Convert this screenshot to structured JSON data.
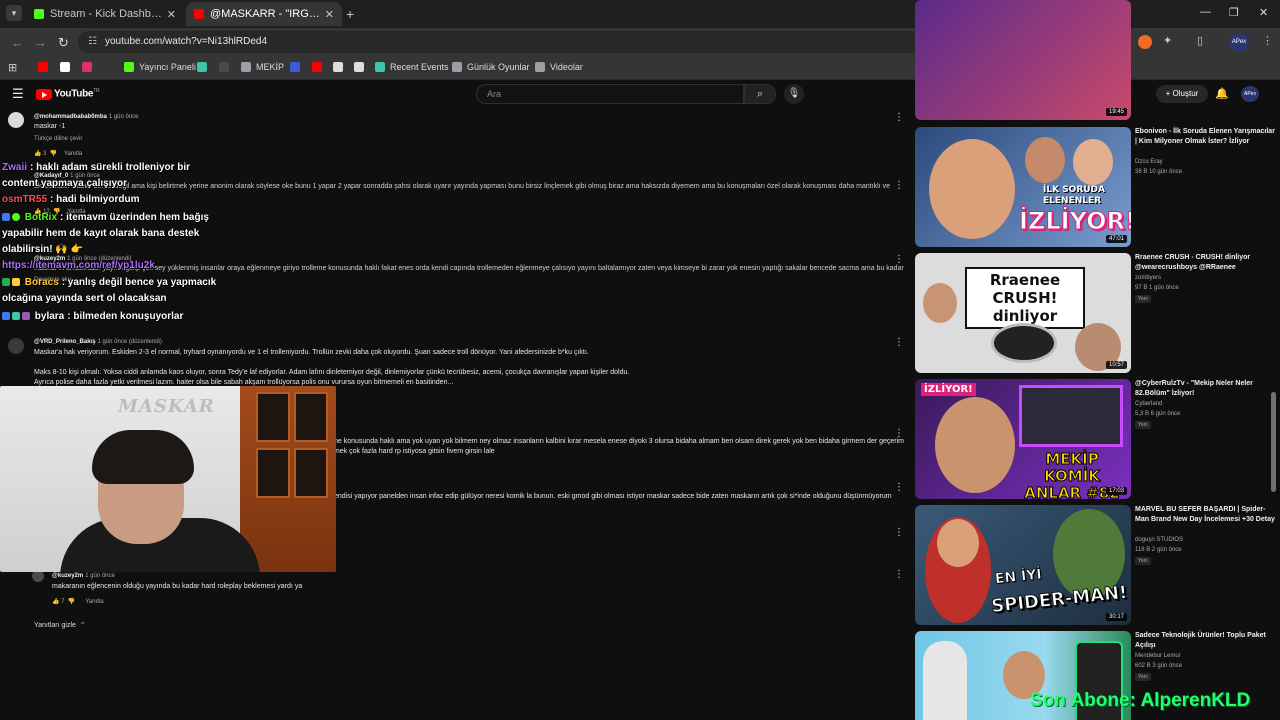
{
  "browser": {
    "tabs": [
      {
        "title": "Stream - Kick Dashboard",
        "color": "#53fc18"
      },
      {
        "title": "@MASKARR - \"IRGATLARIN GÜ",
        "color": "#ff0000"
      }
    ],
    "url": "youtube.com/watch?v=Ni13hlRDed4",
    "bookmarks": [
      {
        "label": "",
        "color": "#ff0000"
      },
      {
        "label": "",
        "color": "#ffffff"
      },
      {
        "label": "",
        "color": "#e1306c"
      },
      {
        "label": "Yayıncı Paneli",
        "color": "#53fc18"
      },
      {
        "label": "",
        "color": "#3ec6a8"
      },
      {
        "label": "MEKİP",
        "color": "#9aa0a6"
      },
      {
        "label": "",
        "color": "#3b5bdb"
      },
      {
        "label": "",
        "color": "#ff0000"
      },
      {
        "label": "",
        "color": "#dddddd"
      },
      {
        "label": "",
        "color": "#dddddd"
      },
      {
        "label": "Recent Events",
        "color": "#3ec6a8"
      },
      {
        "label": "Günlük Oyunlar",
        "color": "#9aa0a6"
      },
      {
        "label": "Videolar",
        "color": "#9aa0a6"
      }
    ],
    "profile_label": "APex"
  },
  "youtube": {
    "logo_text": "YouTube",
    "logo_region": "TR",
    "search_placeholder": "Ara",
    "create_label": "+ Oluştur",
    "avatar_label": "APex"
  },
  "comments": {
    "c1_author": "@mohammadbabab0mba",
    "c1_time": "1 gün önce",
    "c1_text": "maskar -1",
    "c1_translate": "Türkçe diline çevir",
    "c1_likes": "3",
    "c1_reply": "Yanıtla",
    "c2_author": "@Kadayıf_0",
    "c2_time": "1 gün önce",
    "c2_text": "aksde haklı olabilir bence değil ama kişi belirtmek yerine anonim olarak söylese oke bunu 1 yapar 2 yapar sonradda şahsi olarak uyarır yayında yapması bunu birsiz linçlemek gibi olmuş biraz ama haksızda diyemem ama bu konuşmaları özel olarak konuşması daha mantıklı ve",
    "c2_likes": "12",
    "c2_reply": "Yanıtla",
    "c3_author": "@kuzey2m",
    "c3_time": "1 gün önce (düzenlendi)",
    "c3_text": "maskar'ın arkasından yayına gelip çok sey yüklenmiş insanlar oraya eğlenmeye giriyo trolleme konusunda haklı fakat enes orda kendi capında trollemeden eğlenmeye çalısıyo yayını baltalamıyor zaten veya kimseye bi zarar yok enesin yaptığı sakalar bencede sacma ama bu kadar",
    "c3_more": "Devamını oku",
    "c4_author": "@VRD_Prileno_Bakış",
    "c4_time": "1 gün önce (düzenlendi)",
    "c4_line1": "Maskar'a hak veriyorum. Eskiden 2-3 el normal, tryhard oynanıyordu ve 1 el trolleniyordu. Trollün zevki daha çok oluyordu. Şuan sadece troll dönüyor. Yani afedersinizde b*ku çıktı.",
    "c4_line2": "Maks 8-10 kişi olmalı. Yoksa ciddi anlamda kaos oluyor, sonra Tedy'e laf ediyorlar. Adam lafını dinletemiyor değil, dinlemiyorlar çünkü tecrübesiz, acemi, çocukça davranışlar yapan kişiler doldu.",
    "c4_line3": "Ayrıca polise daha fazla yetki verilmesi lazım. haiter olsa bile sabah akşam trollüyorsa polis onu vurursa oyun bitmemeli en basitinden...",
    "c5_line1": "ne konusunda haklı ama yok uyan yok bilmem ney olmaz insanların kalbini kırar mesela enese diyoki 3 olursa bidaha almam ben olsam direk gerek yok ben bidaha girmem der geçerim",
    "c5_line2": "mek çok fazla hard rp istiyosa gitsin fivem girsin lale",
    "c6_line1": "endisi yapıyor panelden insan infaz edip gülüyor neresi komik la bunun. eski gmod gibi olması istiyor maskar sadece bide zaten maskarın artık çok  si*inde olduğunu düşünmüyorum",
    "c7_author": "@kuzey2m",
    "c7_time": "1 gün önce",
    "c7_text": "makaranın eğlencenin olduğu yayında bu kadar hard roleplay beklemesi yardı ya",
    "c7_likes": "7",
    "c7_reply": "Yanıtla",
    "hide_replies": "Yanıtları gizle"
  },
  "chat_overlay": {
    "lines": [
      {
        "user": "Zwaii",
        "user_color": "#b06cff",
        "text": ": haklı adam sürekli trolleniyor bir"
      },
      {
        "user": "",
        "user_color": "#ffffff",
        "text": "content yapmaya çalışıyor"
      },
      {
        "user": "osmTR55",
        "user_color": "#ff4d4d",
        "text": ": hadi bilmiyordum"
      },
      {
        "user": "BotRix",
        "user_color": "#53fc18",
        "text": ": itemavm üzerinden hem bağış"
      },
      {
        "user": "",
        "user_color": "#ffffff",
        "text": "yapabilir hem de kayıt olarak bana destek"
      },
      {
        "user": "",
        "user_color": "#ffffff",
        "text": "olabilirsin! 🙌 👉"
      },
      {
        "user": "",
        "user_color": "#b06cff",
        "text": "https://itemavm.com/ref/yp1lu2k"
      },
      {
        "user": "Boracs",
        "user_color": "#ffcc33",
        "text": ": yanlış değil bence ya yapmacık"
      },
      {
        "user": "",
        "user_color": "#ffffff",
        "text": "olcağına yayında sert ol olacaksan"
      },
      {
        "user": "bylara",
        "user_color": "#ffffff",
        "text": ": bilmeden konuşuyorlar"
      }
    ]
  },
  "webcam": {
    "wall_text": "MASKAR"
  },
  "recommended": [
    {
      "title": "",
      "channel": "",
      "meta": "",
      "badge": "",
      "duration": "19:45"
    },
    {
      "title": "Ebonivon - İlk Soruda Elenen Yarışmacılar | Kim Milyoner Olmak İster? İzliyor",
      "channel": "Dzcu Eray",
      "meta": "38 B   10 gün önce",
      "badge": "",
      "duration": "47:01",
      "thumb_text": "İZLİYOR!",
      "thumb_sub": "İLK SORUDA ELENENLER"
    },
    {
      "title": "Rraenee CRUSH - CRUSH! dinliyor @wearecrushboys @RRaenee",
      "channel": "zombyers",
      "meta": "97 B   1 gün önce",
      "badge": "Yeni",
      "duration": "10:57",
      "thumb_text": "Rraenee CRUSH! dinliyor"
    },
    {
      "title": "@CyberRulzTv - \"Mekip Neler Neler 82.Bölüm\" İzliyor!",
      "channel": "Cyberland",
      "meta": "5,3 B   6 gün önce",
      "badge": "Yeni",
      "duration": "17:03",
      "thumb_text": "MEKİP KOMİK ANLAR #82",
      "thumb_sub": "İZLİYOR!"
    },
    {
      "title": "MARVEL BU SEFER BAŞARDI | Spider-Man Brand New Day İncelemesi +30 Detay",
      "channel": "doguşn STUDIOS",
      "meta": "118 B   2 gün önce",
      "badge": "Yeni",
      "duration": "30:17",
      "thumb_text": "EN İYİ SPIDER-MAN!"
    },
    {
      "title": "Sadece Teknolojik Ürünler! Toplu Paket Açılışı",
      "channel": "Mendebur Lemur",
      "meta": "602 B   3 gün önce",
      "badge": "Yeni",
      "duration": ""
    }
  ],
  "sub_overlay": "Son Abone: AlperenKLD"
}
